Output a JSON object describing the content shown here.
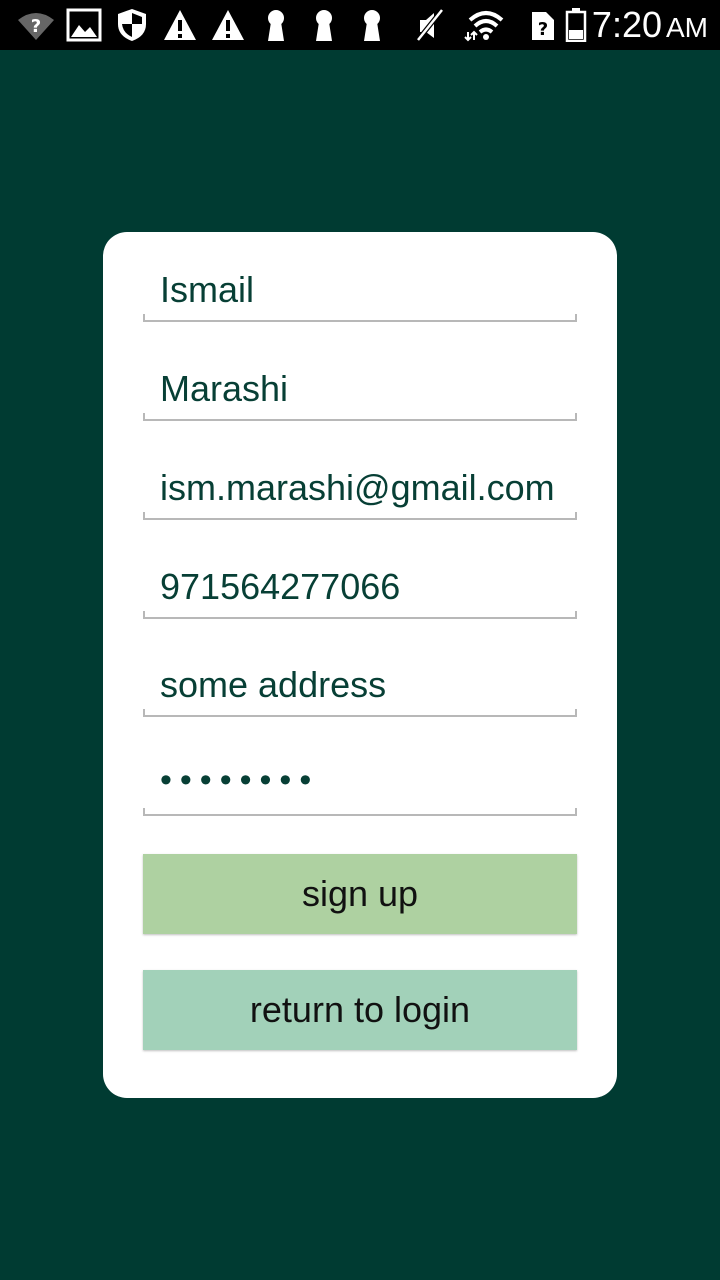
{
  "status_bar": {
    "time": "7:20",
    "ampm": "AM",
    "icons": [
      "wifi-unknown-icon",
      "image-icon",
      "shield-icon",
      "warning-icon",
      "warning-icon",
      "keyhole-icon",
      "keyhole-icon",
      "keyhole-icon",
      "mute-icon",
      "wifi-icon",
      "sim-unknown-icon",
      "battery-icon"
    ]
  },
  "form": {
    "first_name": "Ismail",
    "last_name": "Marashi",
    "email": "ism.marashi@gmail.com",
    "phone": "971564277066",
    "address": "some address",
    "password_masked": "••••••••"
  },
  "buttons": {
    "sign_up": "sign up",
    "return_to_login": "return to login"
  },
  "colors": {
    "background": "#003b32",
    "card": "#ffffff",
    "text": "#073f35",
    "sign_up_button": "#aed1a1",
    "login_button": "#a2d1b9"
  }
}
